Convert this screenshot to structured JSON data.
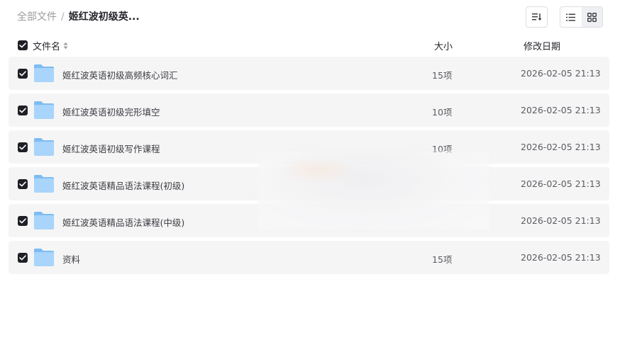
{
  "breadcrumb": {
    "root": "全部文件",
    "separator": "/",
    "current": "姬红波初级英..."
  },
  "toolbar": {
    "sort_icon": "sort-lines-icon",
    "view_list_icon": "list-view-icon",
    "view_grid_icon": "grid-view-icon"
  },
  "table": {
    "headers": {
      "name": "文件名",
      "size": "大小",
      "date": "修改日期"
    },
    "rows": [
      {
        "name": "姬红波英语初级高频核心词汇",
        "size": "15项",
        "date": "2026-02-05 21:13"
      },
      {
        "name": "姬红波英语初级完形填空",
        "size": "10项",
        "date": "2026-02-05 21:13"
      },
      {
        "name": "姬红波英语初级写作课程",
        "size": "10项",
        "date": "2026-02-05 21:13"
      },
      {
        "name": "姬红波英语精品语法课程(初级)",
        "size": "",
        "date": "2026-02-05 21:13"
      },
      {
        "name": "姬红波英语精品语法课程(中级)",
        "size": "",
        "date": "2026-02-05 21:13"
      },
      {
        "name": "资料",
        "size": "15项",
        "date": "2026-02-05 21:13"
      }
    ]
  },
  "colors": {
    "checkbox": "#1f2025",
    "row_bg": "#f5f5f6",
    "folder_light": "#a9d4fb",
    "folder_dark": "#7dbcf3"
  }
}
